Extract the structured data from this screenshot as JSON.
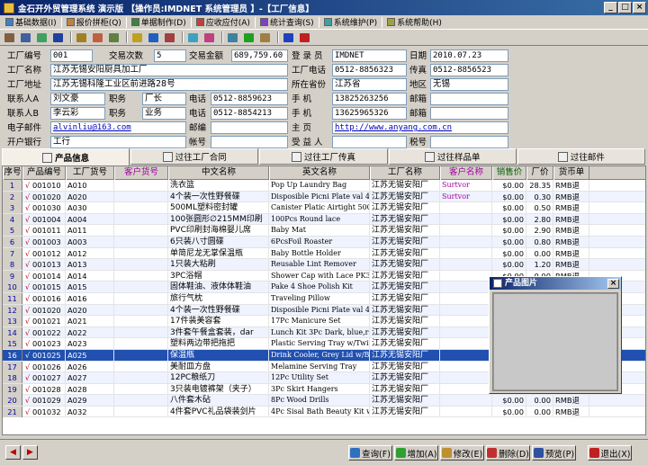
{
  "window": {
    "title": "金石开外贸管理系统 演示版 【操作员:IMDNET 系统管理员 】-【工厂信息】",
    "buttons": [
      "_",
      "□",
      "×"
    ]
  },
  "menu": [
    {
      "label": "基础数据(I)",
      "icon_color": "#4080c0"
    },
    {
      "label": "报价拼柜(Q)",
      "icon_color": "#c08040"
    },
    {
      "label": "单据制作(D)",
      "icon_color": "#408040"
    },
    {
      "label": "应收应付(A)",
      "icon_color": "#c04040"
    },
    {
      "label": "统计查询(S)",
      "icon_color": "#8040c0"
    },
    {
      "label": "系统维护(P)",
      "icon_color": "#40a0a0"
    },
    {
      "label": "系统帮助(H)",
      "icon_color": "#a0a040"
    }
  ],
  "toolbar": {
    "icons": [
      {
        "name": "calculator-icon",
        "color": "#806040"
      },
      {
        "name": "database-icon",
        "color": "#4060a0"
      },
      {
        "name": "image-icon",
        "color": "#40a060"
      },
      {
        "name": "table-icon",
        "color": "#2040a0"
      },
      {
        "name": "sep"
      },
      {
        "name": "money-bag-icon",
        "color": "#a08020"
      },
      {
        "name": "clipboard-icon",
        "color": "#c06040"
      },
      {
        "name": "document-icon",
        "color": "#608040"
      },
      {
        "name": "sep"
      },
      {
        "name": "gift-icon",
        "color": "#c0a020"
      },
      {
        "name": "grid-icon",
        "color": "#2060c0"
      },
      {
        "name": "book-icon",
        "color": "#a04040"
      },
      {
        "name": "sep"
      },
      {
        "name": "wallet-icon",
        "color": "#40a0c0"
      },
      {
        "name": "chart-icon",
        "color": "#c04080"
      },
      {
        "name": "sep"
      },
      {
        "name": "monitor-icon",
        "color": "#4080a0"
      },
      {
        "name": "refresh-icon",
        "color": "#20a020"
      },
      {
        "name": "lock-icon",
        "color": "#a08040"
      },
      {
        "name": "sep"
      },
      {
        "name": "help-icon",
        "color": "#2040c0"
      },
      {
        "name": "exit-icon",
        "color": "#c02020"
      }
    ]
  },
  "form": {
    "factory_code_label": "工厂编号",
    "factory_code": "001",
    "trade_count_label": "交易次数",
    "trade_count": "5",
    "trade_amount_label": "交易金额",
    "trade_amount": "689,759.60",
    "registrant_label": "登 录 员",
    "registrant": "IMDNET",
    "date_label": "日期",
    "date": "2010.07.23",
    "factory_name_label": "工厂名称",
    "factory_name": "江苏无锡安阳厨具加工厂",
    "factory_phone_label": "工厂电话",
    "factory_phone": "0512-8856323",
    "fax_label": "传真",
    "fax": "0512-8856523",
    "factory_address_label": "工厂地址",
    "factory_address": "江苏无锡科隆工业区前进路28号",
    "province_label": "所在省份",
    "province": "江苏省",
    "region_label": "地区",
    "region": "无锡",
    "contact_a_label": "联系人A",
    "contact_a": "刘文豪",
    "duty_a_label": "职务",
    "duty_a": "厂长",
    "phone_a_label": "电话",
    "phone_a": "0512-8859623",
    "mobile_a_label": "手  机",
    "mobile_a": "13825263256",
    "mail_a_label": "邮箱",
    "mail_a": "",
    "contact_b_label": "联系人B",
    "contact_b": "李云彩",
    "duty_b_label": "职务",
    "duty_b": "业务",
    "phone_b_label": "电话",
    "phone_b": "0512-8854213",
    "mobile_b_label": "手  机",
    "mobile_b": "13625965326",
    "mail_b_label": "邮箱",
    "mail_b": "",
    "email_label": "电子邮件",
    "email": "alvinliu@163.com",
    "postcode_label": "邮编",
    "postcode": "",
    "homepage_label": "主  页",
    "homepage": "http://www.anyang.com.cn",
    "bank_label": "开户银行",
    "bank": "工行",
    "account_label": "帐号",
    "account": "",
    "beneficiary_label": "受 益 人",
    "beneficiary": "",
    "taxno_label": "税号",
    "taxno": ""
  },
  "tabs": [
    {
      "label": "产品信息",
      "active": true
    },
    {
      "label": "过往工厂合同",
      "active": false
    },
    {
      "label": "过往工厂传真",
      "active": false
    },
    {
      "label": "过往样品单",
      "active": false
    },
    {
      "label": "过往邮件",
      "active": false
    }
  ],
  "grid": {
    "columns": [
      "序号",
      "产品编号",
      "工厂货号",
      "客户货号",
      "中文名称",
      "英文名称",
      "工厂名称",
      "客户名称",
      "销售价",
      "厂价",
      "货币单"
    ],
    "rows": [
      {
        "no": "1",
        "chk": "√",
        "code": "001010",
        "fno": "A010",
        "cno": "",
        "cn": "洗衣篮",
        "en": "Pop Up Laundry Bag",
        "factory": "江苏无锡安阳厂",
        "cust": "Surtvor",
        "price": "$0.00",
        "fprice": "28.35",
        "cur": "RMB退"
      },
      {
        "no": "2",
        "chk": "√",
        "code": "001020",
        "fno": "A020",
        "cno": "",
        "cn": "4个装一次性野餐碟",
        "en": "Disposible Picni Plate val 4 Pk",
        "factory": "江苏无锡安阳厂",
        "cust": "Surtvor",
        "price": "$0.00",
        "fprice": "0.30",
        "cur": "RMB退"
      },
      {
        "no": "3",
        "chk": "√",
        "code": "001030",
        "fno": "A030",
        "cno": "",
        "cn": "500ML塑料密封罐",
        "en": "Canister Platic Airtight 500 ML",
        "factory": "江苏无锡安阳厂",
        "cust": "",
        "price": "$0.00",
        "fprice": "0.50",
        "cur": "RMB退"
      },
      {
        "no": "4",
        "chk": "√",
        "code": "001004",
        "fno": "A004",
        "cno": "",
        "cn": "100张圆形∅215MM印刷",
        "en": "100Pcs Round lace",
        "factory": "江苏无锡安阳厂",
        "cust": "",
        "price": "$0.00",
        "fprice": "2.80",
        "cur": "RMB退"
      },
      {
        "no": "5",
        "chk": "√",
        "code": "001011",
        "fno": "A011",
        "cno": "",
        "cn": "PVC印刷封海棉婴儿席",
        "en": "Baby Mat",
        "factory": "江苏无锡安阳厂",
        "cust": "",
        "price": "$0.00",
        "fprice": "2.90",
        "cur": "RMB退"
      },
      {
        "no": "6",
        "chk": "√",
        "code": "001003",
        "fno": "A003",
        "cno": "",
        "cn": "6只装八寸圆碟",
        "en": "6PcsFoil Roaster",
        "factory": "江苏无锡安阳厂",
        "cust": "",
        "price": "$0.00",
        "fprice": "0.80",
        "cur": "RMB退"
      },
      {
        "no": "7",
        "chk": "√",
        "code": "001012",
        "fno": "A012",
        "cno": "",
        "cn": "单简尼龙无掌保温瓶",
        "en": "Baby Bottle Holder",
        "factory": "江苏无锡安阳厂",
        "cust": "",
        "price": "$0.00",
        "fprice": "0.00",
        "cur": "RMB退"
      },
      {
        "no": "8",
        "chk": "√",
        "code": "001013",
        "fno": "A013",
        "cno": "",
        "cn": "1只装大粘刷",
        "en": "Reusable Lint Remover",
        "factory": "江苏无锡安阳厂",
        "cust": "",
        "price": "$0.00",
        "fprice": "1.20",
        "cur": "RMB退"
      },
      {
        "no": "9",
        "chk": "√",
        "code": "001014",
        "fno": "A014",
        "cno": "",
        "cn": "3PC浴帽",
        "en": "Shower Cap with Lace PK3",
        "factory": "江苏无锡安阳厂",
        "cust": "",
        "price": "$0.00",
        "fprice": "0.00",
        "cur": "RMB退"
      },
      {
        "no": "10",
        "chk": "√",
        "code": "001015",
        "fno": "A015",
        "cno": "",
        "cn": "固体鞋油、液体体鞋油",
        "en": "Pake 4 Shoe Polish Kit",
        "factory": "江苏无锡安阳厂",
        "cust": "",
        "price": "$0.00",
        "fprice": "0.00",
        "cur": "RMB退"
      },
      {
        "no": "11",
        "chk": "√",
        "code": "001016",
        "fno": "A016",
        "cno": "",
        "cn": "旅行气枕",
        "en": "Traveling Pillow",
        "factory": "江苏无锡安阳厂",
        "cust": "",
        "price": "$0.00",
        "fprice": "0.00",
        "cur": "RMB退"
      },
      {
        "no": "12",
        "chk": "√",
        "code": "001020",
        "fno": "A020",
        "cno": "",
        "cn": "4个装一次性野餐碟",
        "en": "Disposible Picni Plate val 4 Pk",
        "factory": "江苏无锡安阳厂",
        "cust": "",
        "price": "$0.00",
        "fprice": "0.00",
        "cur": "RMB退"
      },
      {
        "no": "13",
        "chk": "√",
        "code": "001021",
        "fno": "A021",
        "cno": "",
        "cn": "17件装美容套",
        "en": "17Pc Manicure Set",
        "factory": "江苏无锡安阳厂",
        "cust": "",
        "price": "$0.00",
        "fprice": "0.00",
        "cur": "RMB退"
      },
      {
        "no": "14",
        "chk": "√",
        "code": "001022",
        "fno": "A022",
        "cno": "",
        "cn": "3件套午餐盒套装，dar",
        "en": "Lunch Kit 3Pc Dark, blue,red, g",
        "factory": "江苏无锡安阳厂",
        "cust": "",
        "price": "$0.00",
        "fprice": "0.00",
        "cur": "RMB退"
      },
      {
        "no": "15",
        "chk": "√",
        "code": "001023",
        "fno": "A023",
        "cno": "",
        "cn": "塑料两边带把拖把",
        "en": "Plastic Serving Tray w/Twin Ha",
        "factory": "江苏无锡安阳厂",
        "cust": "",
        "price": "$0.00",
        "fprice": "0.00",
        "cur": "RMB退"
      },
      {
        "no": "16",
        "chk": "√",
        "code": "001025",
        "fno": "A025",
        "cno": "",
        "cn": "保温瓶",
        "en": "Drink Cooler, Grey Lid w/Black",
        "factory": "江苏无锡安阳厂",
        "cust": "",
        "price": "",
        "fprice": "",
        "cur": "USD"
      },
      {
        "no": "17",
        "chk": "√",
        "code": "001026",
        "fno": "A026",
        "cno": "",
        "cn": "美耐皿方盘",
        "en": "Melamine Serving Tray",
        "factory": "江苏无锡安阳厂",
        "cust": "",
        "price": "$0.00",
        "fprice": "0.00",
        "cur": "USD"
      },
      {
        "no": "18",
        "chk": "√",
        "code": "001027",
        "fno": "A027",
        "cno": "",
        "cn": "12PC粮纸刀",
        "en": "12Pc Utility Set",
        "factory": "江苏无锡安阳厂",
        "cust": "",
        "price": "$0.00",
        "fprice": "0.00",
        "cur": "RMB退"
      },
      {
        "no": "19",
        "chk": "√",
        "code": "001028",
        "fno": "A028",
        "cno": "",
        "cn": "3只装电镀裤架（夹子）",
        "en": "3Pc Skirt Hangers",
        "factory": "江苏无锡安阳厂",
        "cust": "",
        "price": "$0.00",
        "fprice": "0.00",
        "cur": "RMB退"
      },
      {
        "no": "20",
        "chk": "√",
        "code": "001029",
        "fno": "A029",
        "cno": "",
        "cn": "八件套木砧",
        "en": "8Pc Wood Drills",
        "factory": "江苏无锡安阳厂",
        "cust": "",
        "price": "$0.00",
        "fprice": "0.00",
        "cur": "RMB退"
      },
      {
        "no": "21",
        "chk": "√",
        "code": "001032",
        "fno": "A032",
        "cno": "",
        "cn": "4件套PVC礼品袋装剑片",
        "en": "4Pc Sisal Bath Beauty Kit w/P'",
        "factory": "江苏无锡安阳厂",
        "cust": "",
        "price": "$0.00",
        "fprice": "0.00",
        "cur": "RMB退"
      }
    ],
    "selected_row": 15
  },
  "popup": {
    "title": "产品图片",
    "close": "×"
  },
  "bottom": {
    "nav_prev": "◀",
    "nav_next": "▶",
    "buttons": [
      {
        "label": "查询(F)",
        "icon_color": "#3070c0"
      },
      {
        "label": "增加(A)",
        "icon_color": "#30a030"
      },
      {
        "label": "修改(E)",
        "icon_color": "#c09030"
      },
      {
        "label": "删除(D)",
        "icon_color": "#c03030"
      },
      {
        "label": "预览(P)",
        "icon_color": "#3050a0"
      },
      {
        "label": "退出(X)",
        "icon_color": "#c02020"
      }
    ]
  }
}
